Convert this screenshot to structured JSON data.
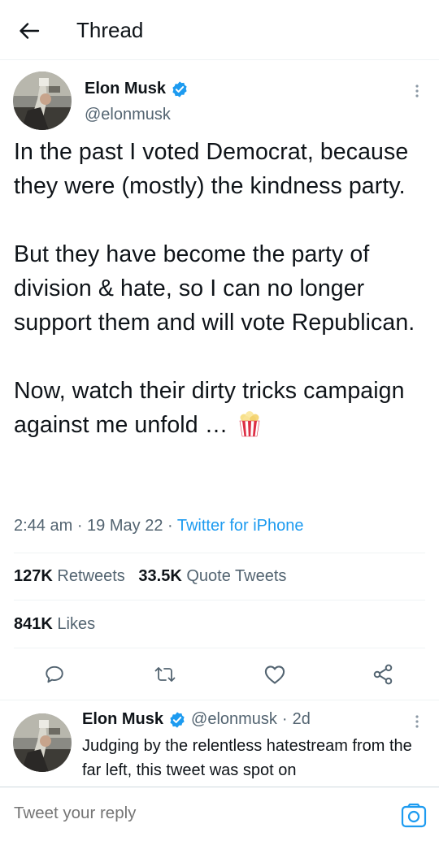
{
  "header": {
    "title": "Thread",
    "back_icon": "arrow-left-icon"
  },
  "tweet": {
    "author_name": "Elon Musk",
    "handle": "@elonmusk",
    "verified": true,
    "text": "In the past I voted Democrat, because they were (mostly) the kindness party.\n\nBut they have become the party of division & hate, so I can no longer support them and will vote Republican.\n\nNow, watch their dirty tricks campaign against me unfold … ",
    "emoji": "popcorn-icon",
    "time": "2:44 am",
    "date": "19 May 22",
    "source": "Twitter for iPhone",
    "retweets_count": "127K",
    "retweets_label": "Retweets",
    "quotes_count": "33.5K",
    "quotes_label": "Quote Tweets",
    "likes_count": "841K",
    "likes_label": "Likes"
  },
  "actions": [
    "reply-icon",
    "retweet-icon",
    "like-icon",
    "share-icon"
  ],
  "reply": {
    "author_name": "Elon Musk",
    "handle": "@elonmusk",
    "age": "2d",
    "text": "Judging by the relentless hatestream from the far left, this tweet was spot on"
  },
  "composer": {
    "placeholder": "Tweet your reply",
    "camera_icon": "camera-icon"
  },
  "colors": {
    "accent": "#1d9bf0",
    "text": "#0f1419",
    "secondary": "#536471",
    "divider": "#eff3f4"
  }
}
